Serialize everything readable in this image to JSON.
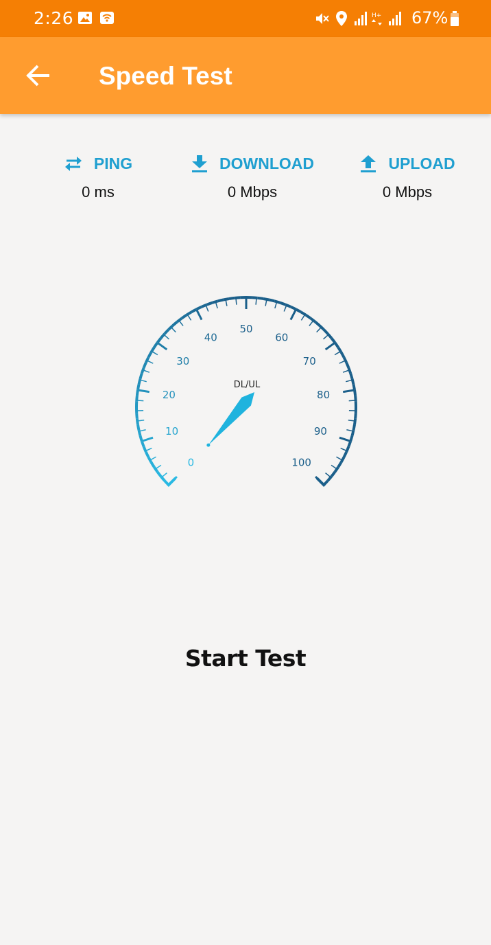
{
  "status_bar": {
    "time": "2:26",
    "battery": "67%",
    "background_color": "#f57f04",
    "icons": [
      "image-icon",
      "wifi-calling-icon",
      "mute-icon",
      "location-icon",
      "signal-icon",
      "data-arrows-icon",
      "signal-icon",
      "battery-icon"
    ]
  },
  "app_bar": {
    "title": "Speed Test",
    "background_color": "#ff9c2f",
    "back_icon": "arrow-back-icon"
  },
  "metrics": {
    "ping": {
      "label": "PING",
      "value": "0 ms",
      "icon": "swap-arrows-icon"
    },
    "download": {
      "label": "DOWNLOAD",
      "value": "0 Mbps",
      "icon": "download-icon"
    },
    "upload": {
      "label": "UPLOAD",
      "value": "0 Mbps",
      "icon": "upload-icon"
    },
    "accent_color": "#1f9fd0"
  },
  "gauge": {
    "center_label": "DL/UL",
    "min": 0,
    "max": 100,
    "value": 0,
    "tick_labels": [
      "0",
      "10",
      "20",
      "30",
      "40",
      "50",
      "60",
      "70",
      "80",
      "90",
      "100"
    ],
    "arc_color_start": "#29b9e3",
    "arc_color_end": "#1b5f8a"
  },
  "actions": {
    "start_label": "Start Test"
  }
}
